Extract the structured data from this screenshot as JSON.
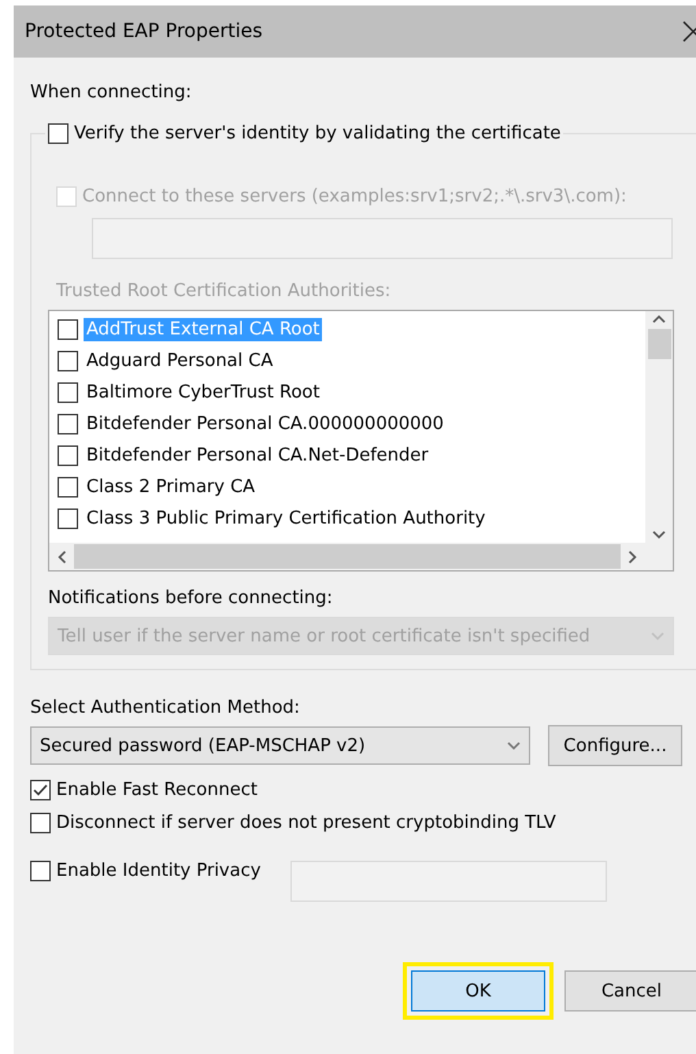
{
  "window": {
    "title": "Protected EAP Properties"
  },
  "when_connecting_label": "When connecting:",
  "verify": {
    "label": "Verify the server's identity by validating the certificate",
    "checked": false
  },
  "connect_servers": {
    "label": "Connect to these servers (examples:srv1;srv2;.*\\.srv3\\.com):",
    "checked": false,
    "disabled": true
  },
  "trusted_label": "Trusted Root Certification Authorities:",
  "authorities": [
    {
      "name": "AddTrust External CA Root",
      "checked": false,
      "selected": true
    },
    {
      "name": "Adguard Personal CA",
      "checked": false,
      "selected": false
    },
    {
      "name": "Baltimore CyberTrust Root",
      "checked": false,
      "selected": false
    },
    {
      "name": "Bitdefender Personal CA.000000000000",
      "checked": false,
      "selected": false
    },
    {
      "name": "Bitdefender Personal CA.Net-Defender",
      "checked": false,
      "selected": false
    },
    {
      "name": "Class 2 Primary CA",
      "checked": false,
      "selected": false
    },
    {
      "name": "Class 3 Public Primary Certification Authority",
      "checked": false,
      "selected": false
    }
  ],
  "notifications_label": "Notifications before connecting:",
  "notifications_value": "Tell user if the server name or root certificate isn't specified",
  "auth_label": "Select Authentication Method:",
  "auth_value": "Secured password (EAP-MSCHAP v2)",
  "configure_button": "Configure...",
  "options": [
    {
      "label": "Enable Fast Reconnect",
      "checked": true
    },
    {
      "label": "Disconnect if server does not present cryptobinding TLV",
      "checked": false
    },
    {
      "label": "Enable Identity Privacy",
      "checked": false
    }
  ],
  "buttons": [
    {
      "label": "OK",
      "highlighted": true
    },
    {
      "label": "Cancel",
      "highlighted": false
    }
  ]
}
